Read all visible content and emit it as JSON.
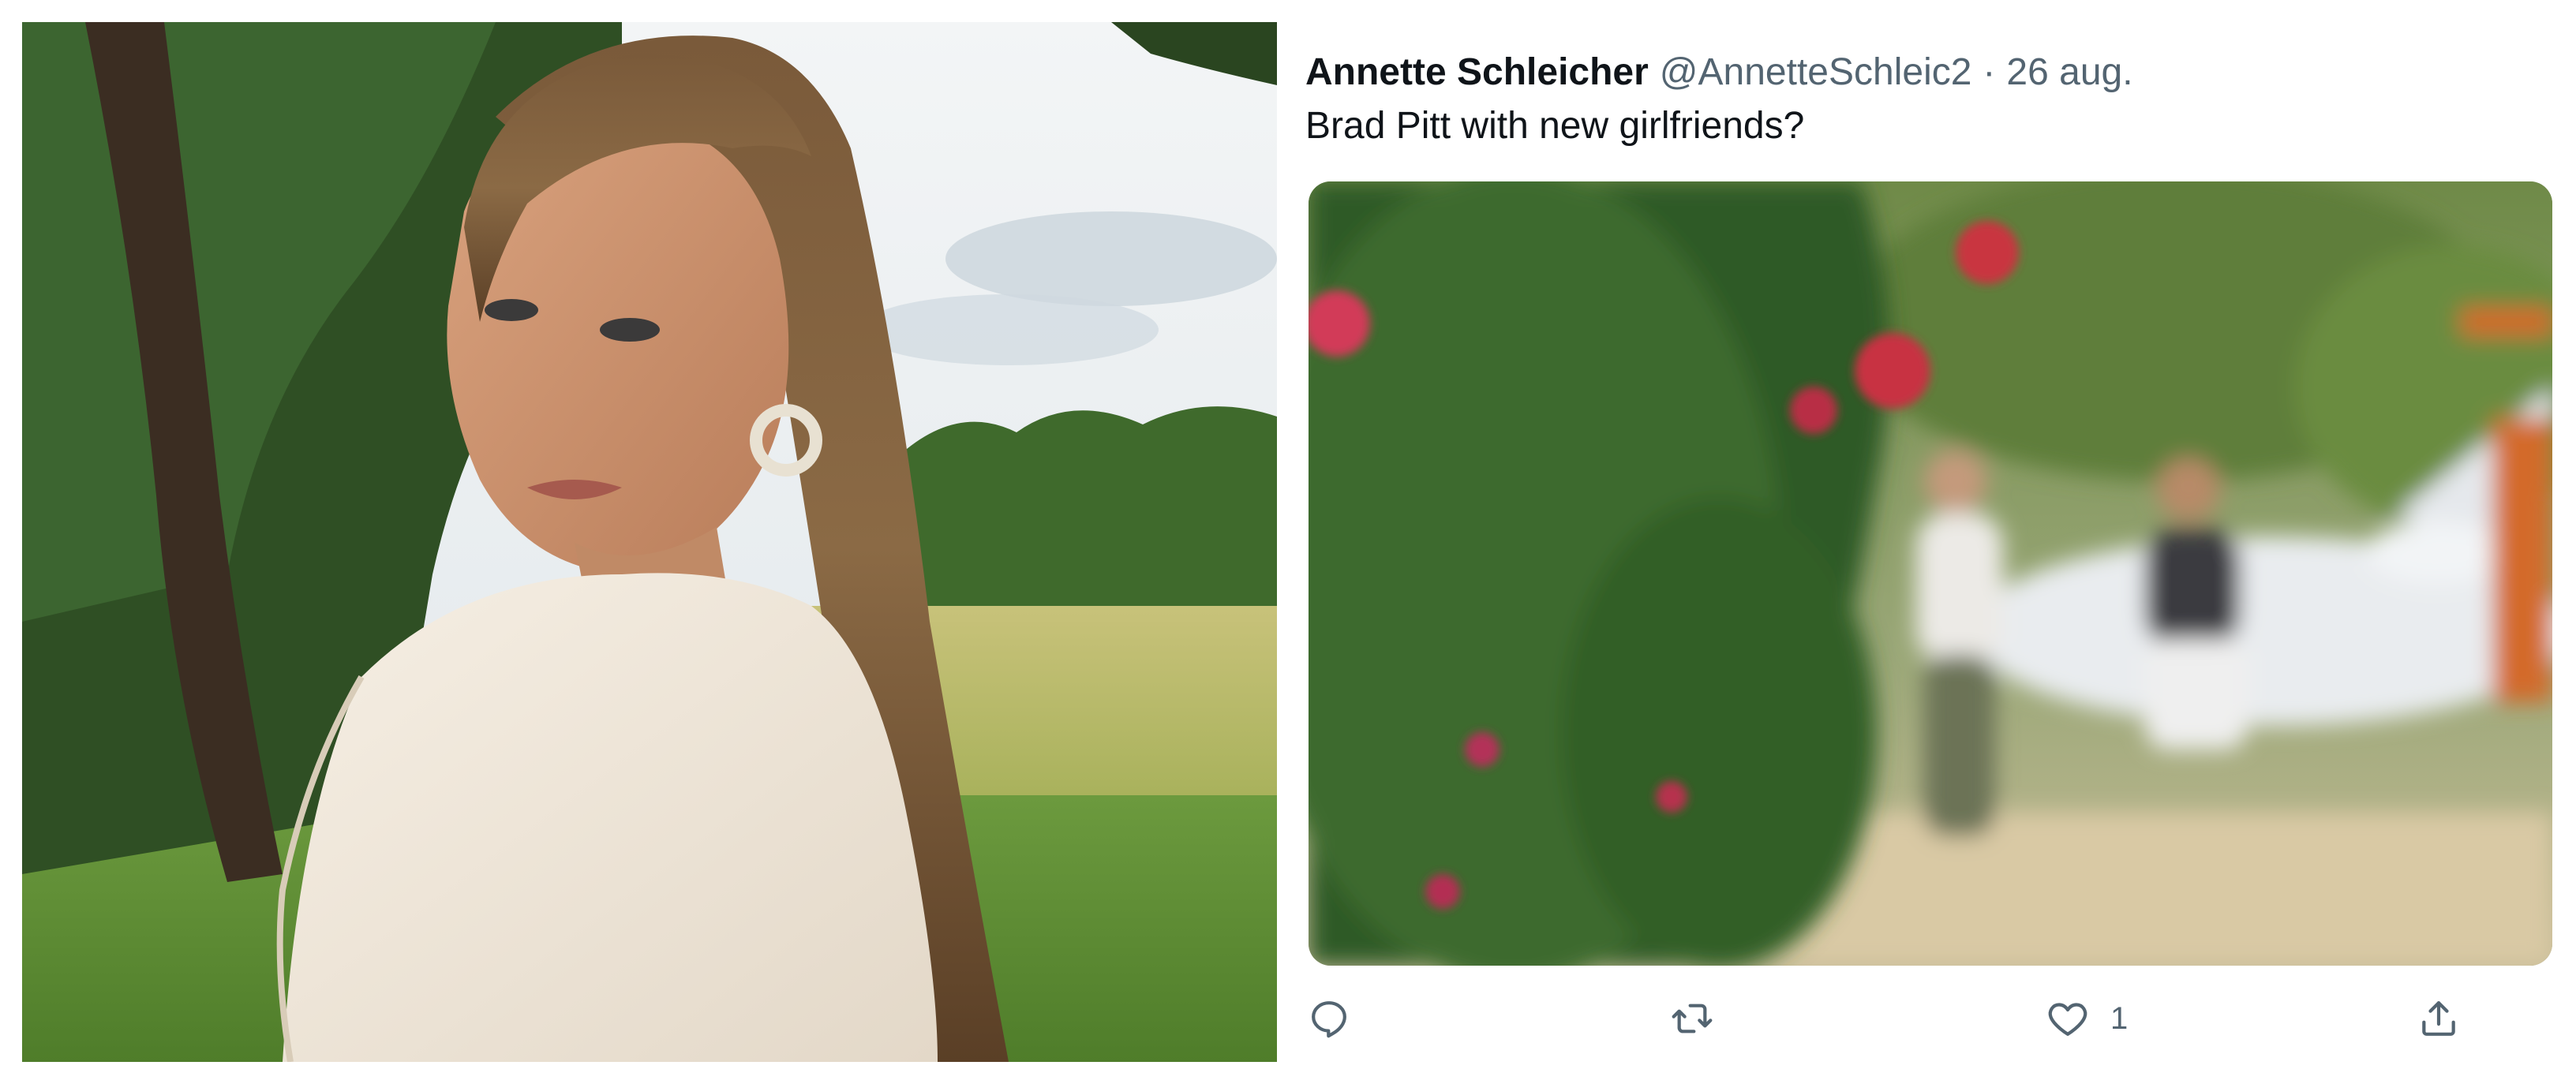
{
  "tweet": {
    "author_name": "Annette Schleicher",
    "author_handle": "@AnnetteSchleic2",
    "separator": "·",
    "date": "26 aug.",
    "text": "Brad Pitt with new girlfriends?",
    "actions": {
      "reply_icon": "reply-icon",
      "retweet_icon": "retweet-icon",
      "like_icon": "heart-icon",
      "like_count": "1",
      "share_icon": "share-icon"
    }
  },
  "colors": {
    "name_text": "#0f1419",
    "secondary_text": "#536471"
  }
}
